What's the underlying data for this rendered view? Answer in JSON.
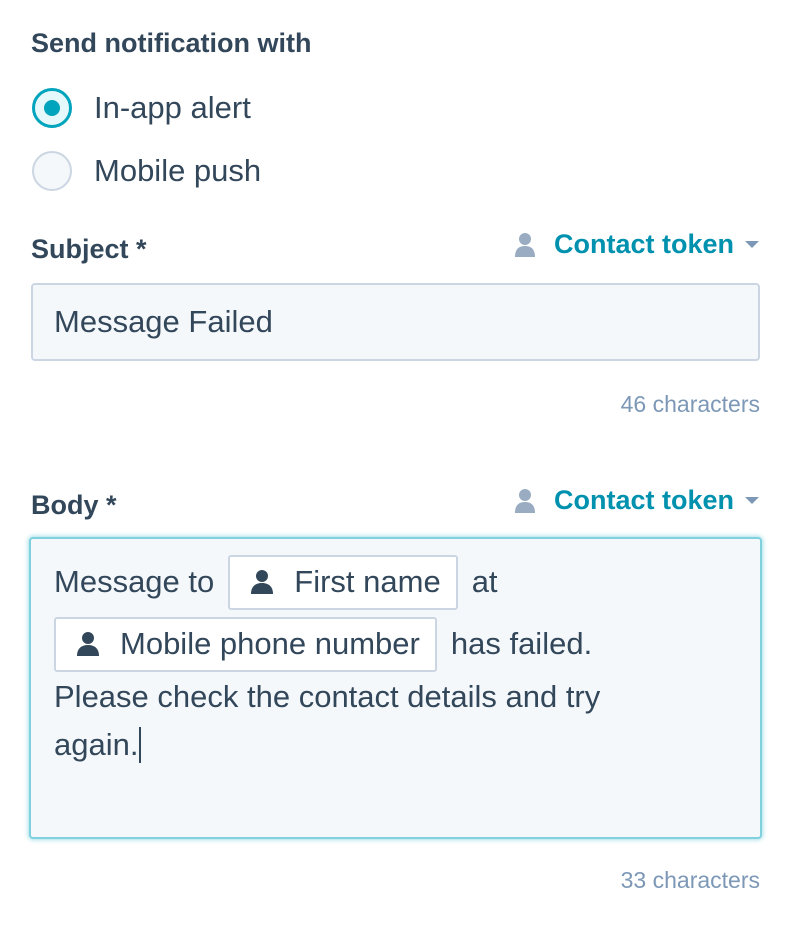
{
  "notification": {
    "label": "Send notification with",
    "options": [
      {
        "label": "In-app alert",
        "checked": true
      },
      {
        "label": "Mobile push",
        "checked": false
      }
    ]
  },
  "subject": {
    "label": "Subject *",
    "token_link": "Contact token",
    "value": "Message Failed",
    "char_count": "46 characters"
  },
  "body": {
    "label": "Body *",
    "token_link": "Contact token",
    "text_1": "Message to",
    "token_1": "First name",
    "text_2": "at",
    "token_2": "Mobile phone number",
    "text_3": "has failed.",
    "text_4": "Please check the contact details and try",
    "text_5": "again.",
    "char_count": "33 characters"
  },
  "colors": {
    "accent": "#00a4bd",
    "link": "#0091ae",
    "text": "#33475b",
    "muted": "#7c98b6",
    "border": "#cbd6e2",
    "input_bg": "#f5f8fa",
    "focus_border": "#7fd1de"
  },
  "icons": {
    "person": "person-icon",
    "caret": "caret-down-icon"
  }
}
